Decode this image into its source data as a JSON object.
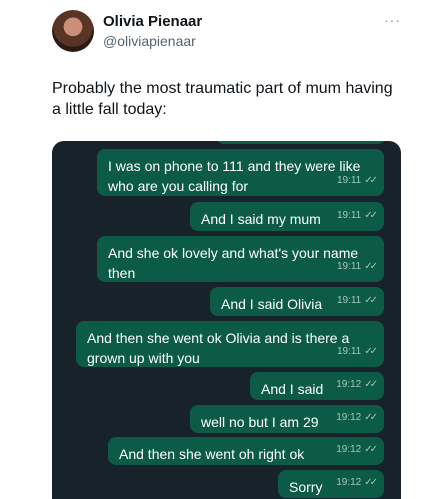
{
  "author": {
    "name": "Olivia Pienaar",
    "handle": "@oliviapienaar"
  },
  "tweet": {
    "text": "Probably the most traumatic part of mum having a little fall today:"
  },
  "icons": {
    "more": "more-horizontal-icon",
    "read_receipt": "double-check-icon"
  },
  "colors": {
    "chat_background": "#17222a",
    "outgoing_bubble": "#0c5b47",
    "handle_grey": "#536471"
  },
  "messages": [
    {
      "text": "I was on phone to 111 and they were like who are you calling for",
      "time": "19:11"
    },
    {
      "text": "And I said my mum",
      "time": "19:11"
    },
    {
      "text": "And she ok lovely and what's your name then",
      "time": "19:11"
    },
    {
      "text": "And I said Olivia",
      "time": "19:11"
    },
    {
      "text": "And then she went ok Olivia and is there a grown up with you",
      "time": "19:11"
    },
    {
      "text": "And I said",
      "time": "19:12"
    },
    {
      "text": "well no but I am 29",
      "time": "19:12"
    },
    {
      "text": "And then she went oh right ok",
      "time": "19:12"
    },
    {
      "text": "Sorry",
      "time": "19:12"
    }
  ]
}
